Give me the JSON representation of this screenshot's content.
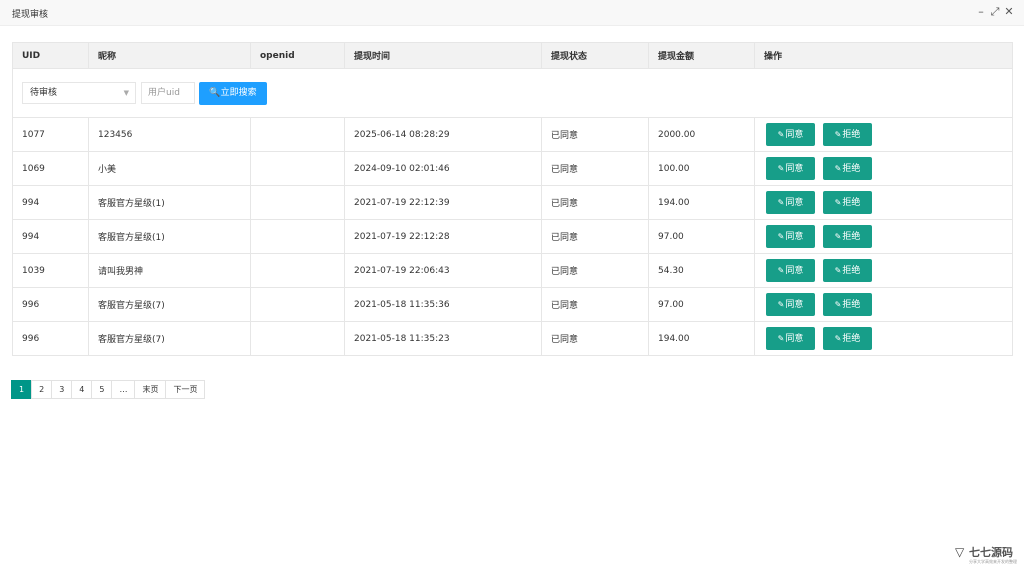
{
  "window": {
    "title": "提现审核"
  },
  "table": {
    "headers": [
      "UID",
      "昵称",
      "openid",
      "提现时间",
      "提现状态",
      "提现金额",
      "操作"
    ],
    "filter": {
      "status_selected": "待审核",
      "uid_placeholder": "用户uid",
      "search_label": "立即搜索"
    },
    "action_labels": {
      "approve": "同意",
      "reject": "拒绝"
    },
    "rows": [
      {
        "uid": "1077",
        "nickname": "123456",
        "openid": "",
        "time": "2025-06-14 08:28:29",
        "status": "已同意",
        "amount": "2000.00"
      },
      {
        "uid": "1069",
        "nickname": "小美",
        "openid": "",
        "time": "2024-09-10 02:01:46",
        "status": "已同意",
        "amount": "100.00"
      },
      {
        "uid": "994",
        "nickname": "客服官方星级(1)",
        "openid": "",
        "time": "2021-07-19 22:12:39",
        "status": "已同意",
        "amount": "194.00"
      },
      {
        "uid": "994",
        "nickname": "客服官方星级(1)",
        "openid": "",
        "time": "2021-07-19 22:12:28",
        "status": "已同意",
        "amount": "97.00"
      },
      {
        "uid": "1039",
        "nickname": "请叫我男神",
        "openid": "",
        "time": "2021-07-19 22:06:43",
        "status": "已同意",
        "amount": "54.30"
      },
      {
        "uid": "996",
        "nickname": "客服官方星级(7)",
        "openid": "",
        "time": "2021-05-18 11:35:36",
        "status": "已同意",
        "amount": "97.00"
      },
      {
        "uid": "996",
        "nickname": "客服官方星级(7)",
        "openid": "",
        "time": "2021-05-18 11:35:23",
        "status": "已同意",
        "amount": "194.00"
      }
    ]
  },
  "pagination": {
    "pages": [
      "1",
      "2",
      "3",
      "4",
      "5",
      "…",
      "末页",
      "下一页"
    ],
    "current": "1"
  },
  "watermark": {
    "brand": "七七源码",
    "slogan": "分享大学高效来开发的整理"
  },
  "colors": {
    "primary": "#179e89",
    "search": "#1e9fff",
    "header_bg": "#f2f2f2"
  },
  "icons": {
    "search": "search-icon",
    "edit": "pencil-icon"
  }
}
